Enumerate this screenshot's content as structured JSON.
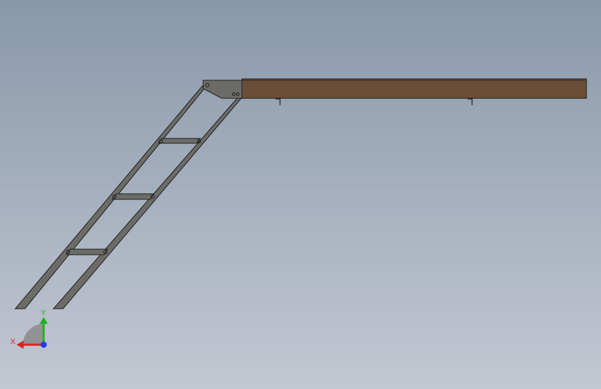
{
  "viewport": {
    "background_top": "#8898aa",
    "background_bottom": "#c3c8d2"
  },
  "model": {
    "deck_color": "#6b4e37",
    "frame_color": "#6b6b68",
    "outline_color": "#1c1c1c"
  },
  "triad": {
    "x_label": "X",
    "y_label": "Y",
    "x_color": "#e02020",
    "y_color": "#20b020",
    "z_color": "#2040e0",
    "icon": "coordinate-triad-icon"
  }
}
